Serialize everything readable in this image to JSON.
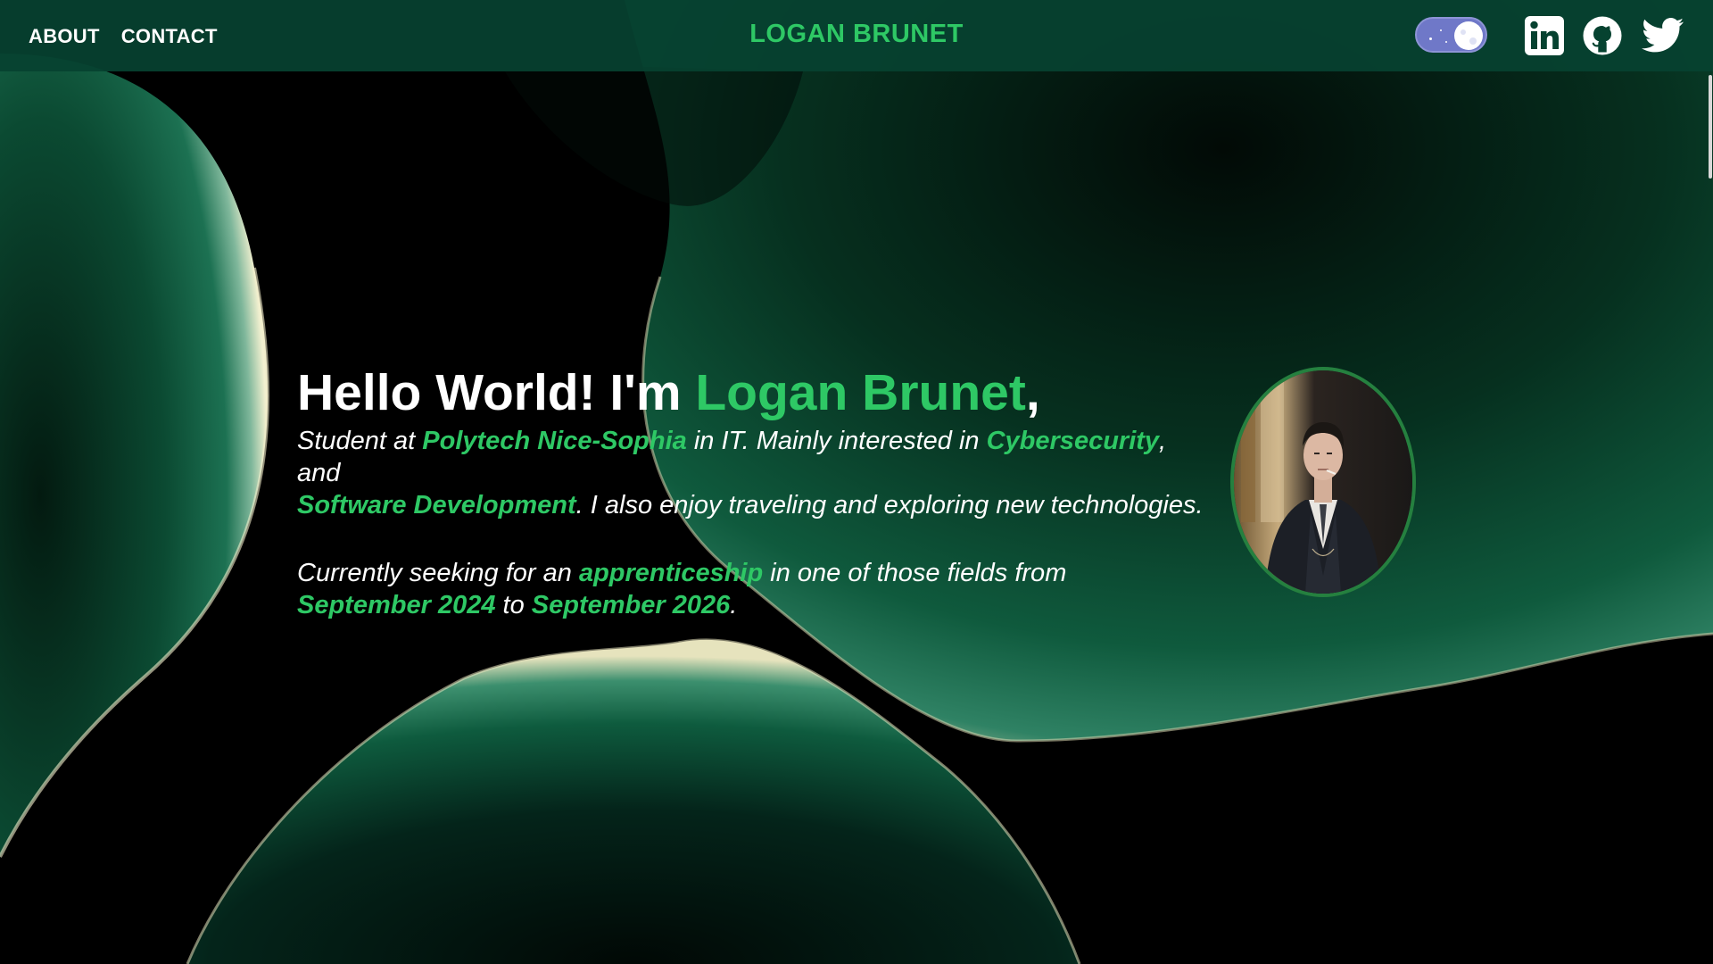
{
  "nav": {
    "about": "ABOUT",
    "contact": "CONTACT"
  },
  "brand": "LOGAN BRUNET",
  "theme_toggle": {
    "state": "dark"
  },
  "social": {
    "linkedin_icon": "linkedin-icon",
    "github_icon": "github-icon",
    "twitter_icon": "twitter-icon"
  },
  "hero": {
    "greeting": "Hello World! I'm ",
    "name": "Logan Brunet",
    "comma": ",",
    "p1": {
      "t1": "Student at ",
      "school": "Polytech Nice-Sophia",
      "t2": " in IT. Mainly interested in ",
      "field1": "Cybersecurity",
      "t3": ", and ",
      "field2": "Software Development",
      "t4": ". I also enjoy traveling and exploring new technologies."
    },
    "p2": {
      "t1": "Currently seeking for an ",
      "kind": "apprenticeship",
      "t2": " in one of those fields from ",
      "start": "September 2024",
      "t3": " to ",
      "end": "September 2026",
      "t4": "."
    }
  },
  "colors": {
    "accent": "#2ec865",
    "header_bg": "#064230",
    "toggle": "#6f78c8",
    "avatar_border": "#25803f"
  }
}
